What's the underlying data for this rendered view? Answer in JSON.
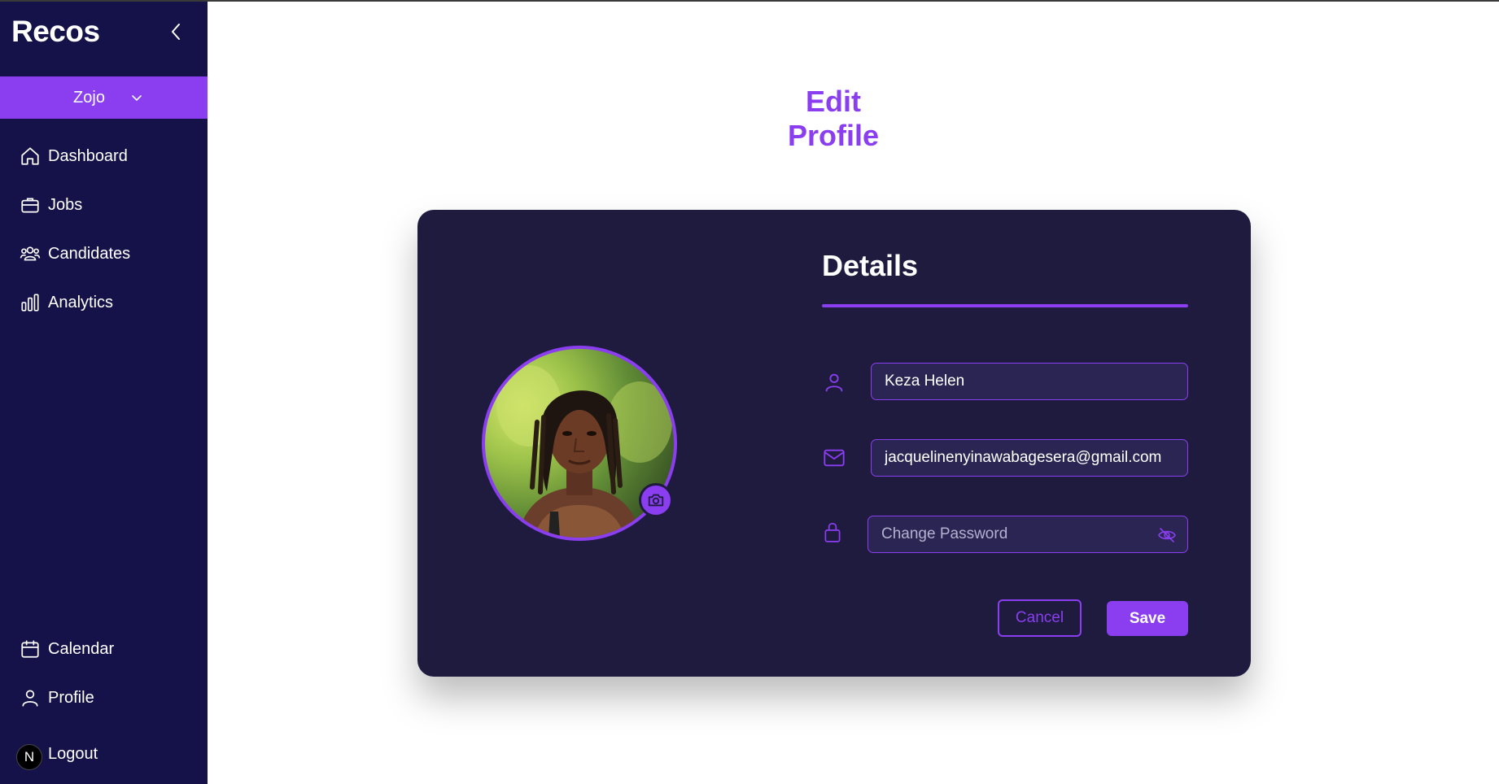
{
  "app": {
    "logo_text": "Recos"
  },
  "sidebar": {
    "workspace": "Zojo",
    "items": [
      {
        "label": "Dashboard",
        "icon": "home-icon"
      },
      {
        "label": "Jobs",
        "icon": "briefcase-icon"
      },
      {
        "label": "Candidates",
        "icon": "users-icon"
      },
      {
        "label": "Analytics",
        "icon": "bar-chart-icon"
      }
    ],
    "bottom_items": [
      {
        "label": "Calendar",
        "icon": "calendar-icon"
      },
      {
        "label": "Profile",
        "icon": "user-icon"
      },
      {
        "label": "Logout",
        "icon": "n-badge-icon",
        "badge_letter": "N"
      }
    ]
  },
  "main": {
    "title": "Edit Profile",
    "card": {
      "heading": "Details",
      "name_value": "Keza Helen",
      "email_value": "jacquelinenyinawabagesera@gmail.com",
      "password_placeholder": "Change Password",
      "cancel_label": "Cancel",
      "save_label": "Save"
    }
  },
  "colors": {
    "sidebar_bg": "#15124a",
    "accent": "#8a3ef0",
    "card_bg": "#1e1b3f"
  }
}
